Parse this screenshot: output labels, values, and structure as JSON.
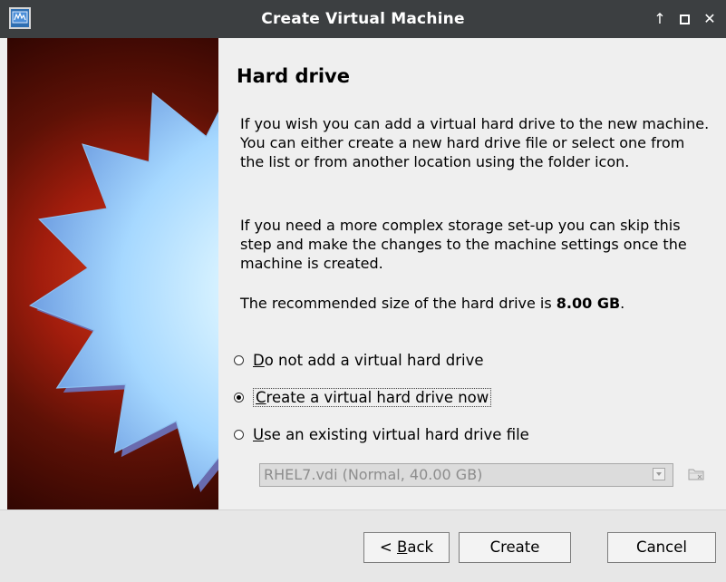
{
  "window": {
    "title": "Create Virtual Machine",
    "controls": [
      "↑",
      "□",
      "✕"
    ]
  },
  "page": {
    "heading": "Hard drive",
    "paragraphs": [
      "If you wish you can add a virtual hard drive to the new machine. You can either create a new hard drive file or select one from the list or from another location using the folder icon.",
      "If you need a more complex storage set-up you can skip this step and make the changes to the machine settings once the machine is created."
    ],
    "recommended_prefix": "The recommended size of the hard drive is ",
    "recommended_size": "8.00 GB",
    "recommended_suffix": "."
  },
  "options": {
    "no_drive": {
      "mnemonic": "D",
      "rest": "o not add a virtual hard drive",
      "selected": false
    },
    "create_now": {
      "mnemonic": "C",
      "rest": "reate a virtual hard drive now",
      "selected": true
    },
    "use_existing": {
      "mnemonic": "U",
      "rest": "se an existing virtual hard drive file",
      "selected": false
    }
  },
  "existing_file": {
    "value": "RHEL7.vdi (Normal, 40.00 GB)",
    "enabled": false
  },
  "buttons": {
    "back_prefix": "< ",
    "back_mnemonic": "B",
    "back_rest": "ack",
    "create": "Create",
    "cancel": "Cancel"
  },
  "colors": {
    "titlebar": "#3c3f41",
    "panel_red": "#a21d0d",
    "star_blue": "#b9e4ff"
  },
  "icons": {
    "app": "virtualbox-icon",
    "folder": "folder-icon",
    "star": "starburst-graphic"
  }
}
